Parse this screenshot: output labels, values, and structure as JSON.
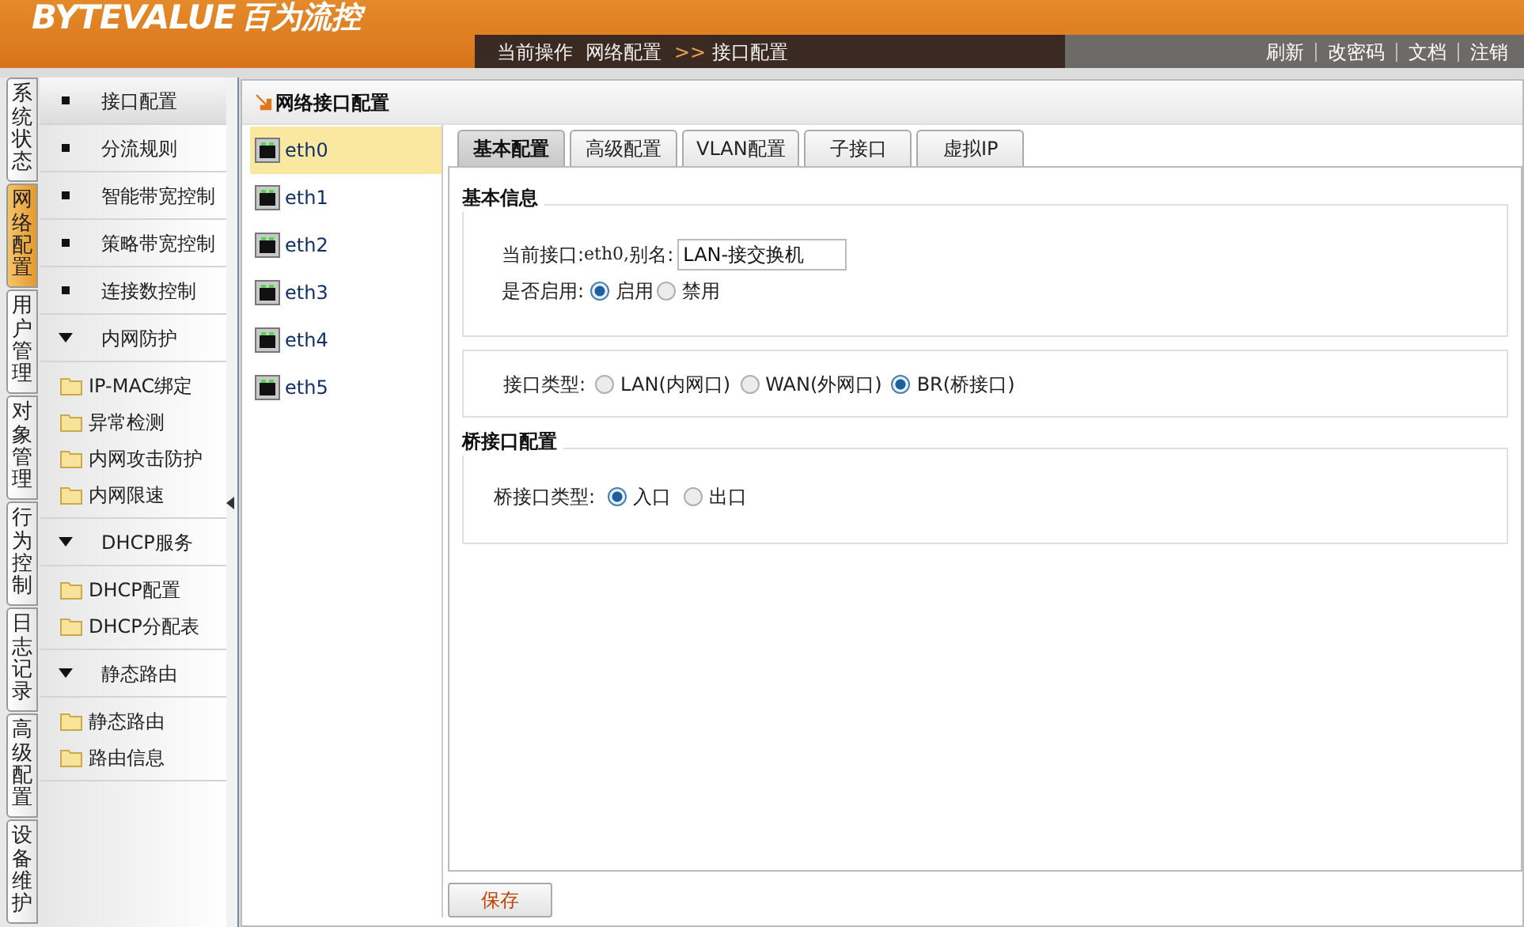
{
  "header": {
    "logo": "BYTEVALUE",
    "logo_cn": "百为流控",
    "breadcrumb_label": "当前操作",
    "breadcrumb": [
      "网络配置",
      "接口配置"
    ],
    "breadcrumb_separator": ">>",
    "links": [
      "刷新",
      "改密码",
      "文档",
      "注销"
    ]
  },
  "side_tabs": [
    {
      "label": "系统状态",
      "selected": false
    },
    {
      "label": "网络配置",
      "selected": true
    },
    {
      "label": "用户管理",
      "selected": false
    },
    {
      "label": "对象管理",
      "selected": false
    },
    {
      "label": "行为控制",
      "selected": false
    },
    {
      "label": "日志记录",
      "selected": false
    },
    {
      "label": "高级配置",
      "selected": false
    },
    {
      "label": "设备维护",
      "selected": false
    }
  ],
  "nav": [
    {
      "kind": "item",
      "label": "接口配置",
      "selected": true
    },
    {
      "kind": "item",
      "label": "分流规则",
      "selected": false
    },
    {
      "kind": "item",
      "label": "智能带宽控制",
      "selected": false
    },
    {
      "kind": "item",
      "label": "策略带宽控制",
      "selected": false
    },
    {
      "kind": "item",
      "label": "连接数控制",
      "selected": false
    },
    {
      "kind": "group",
      "label": "内网防护",
      "expanded": true,
      "children": [
        {
          "label": "IP-MAC绑定"
        },
        {
          "label": "异常检测"
        },
        {
          "label": "内网攻击防护"
        },
        {
          "label": "内网限速"
        }
      ]
    },
    {
      "kind": "group",
      "label": "DHCP服务",
      "expanded": true,
      "children": [
        {
          "label": "DHCP配置"
        },
        {
          "label": "DHCP分配表"
        }
      ]
    },
    {
      "kind": "group",
      "label": "静态路由",
      "expanded": true,
      "children": [
        {
          "label": "静态路由"
        },
        {
          "label": "路由信息"
        }
      ]
    }
  ],
  "panel": {
    "title": "网络接口配置",
    "interfaces": [
      {
        "label": "eth0",
        "selected": true
      },
      {
        "label": "eth1",
        "selected": false
      },
      {
        "label": "eth2",
        "selected": false
      },
      {
        "label": "eth3",
        "selected": false
      },
      {
        "label": "eth4",
        "selected": false
      },
      {
        "label": "eth5",
        "selected": false
      }
    ],
    "tabs": [
      {
        "label": "基本配置",
        "selected": true
      },
      {
        "label": "高级配置",
        "selected": false
      },
      {
        "label": "VLAN配置",
        "selected": false
      },
      {
        "label": "子接口",
        "selected": false
      },
      {
        "label": "虚拟IP",
        "selected": false
      }
    ],
    "basic_info": {
      "title": "基本信息",
      "current_label": "当前接口:",
      "current_value": "eth0,",
      "alias_label": "别名:",
      "alias_value": "LAN-接交换机",
      "enable_label": "是否启用:",
      "enable_options": [
        {
          "label": "启用",
          "selected": true
        },
        {
          "label": "禁用",
          "selected": false
        }
      ]
    },
    "interface_type": {
      "label": "接口类型:",
      "options": [
        {
          "label": "LAN(内网口)",
          "selected": false
        },
        {
          "label": "WAN(外网口)",
          "selected": false
        },
        {
          "label": "BR(桥接口)",
          "selected": true
        }
      ]
    },
    "bridge": {
      "title": "桥接口配置",
      "label": "桥接口类型:",
      "options": [
        {
          "label": "入口",
          "selected": true
        },
        {
          "label": "出口",
          "selected": false
        }
      ]
    },
    "save": "保存"
  }
}
